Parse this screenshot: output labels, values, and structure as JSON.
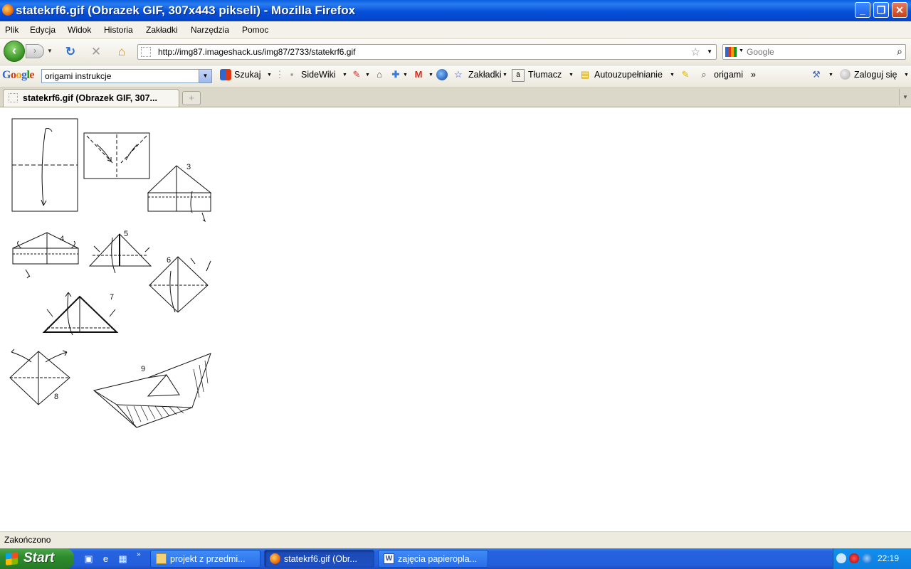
{
  "window": {
    "title": "statekrf6.gif (Obrazek GIF, 307x443 pikseli) - Mozilla Firefox",
    "minimize": "_",
    "maximize": "❐",
    "close": "✕"
  },
  "menu": [
    "Plik",
    "Edycja",
    "Widok",
    "Historia",
    "Zakładki",
    "Narzędzia",
    "Pomoc"
  ],
  "nav": {
    "url": "http://img87.imageshack.us/img87/2733/statekrf6.gif",
    "search_placeholder": "Google"
  },
  "google_toolbar": {
    "logo": [
      "G",
      "o",
      "o",
      "g",
      "l",
      "e"
    ],
    "query": "origami instrukcje",
    "search_label": "Szukaj",
    "sidewiki_label": "SideWiki",
    "bookmarks_label": "Zakładki",
    "translate_label": "Tłumacz",
    "autofill_label": "Autouzupełnianie",
    "origami_label": "origami",
    "more_label": "»",
    "login_label": "Zaloguj się"
  },
  "tabs": {
    "active_title": "statekrf6.gif (Obrazek GIF, 307..."
  },
  "image": {
    "labels": [
      "3",
      "4",
      "5",
      "6",
      "7",
      "8",
      "9"
    ]
  },
  "status": {
    "text": "Zakończono"
  },
  "taskbar": {
    "start_label": "Start",
    "tasks": [
      "projekt z przedmi...",
      "statekrf6.gif (Obr...",
      "zajęcia papieropla..."
    ],
    "clock": "22:19"
  }
}
